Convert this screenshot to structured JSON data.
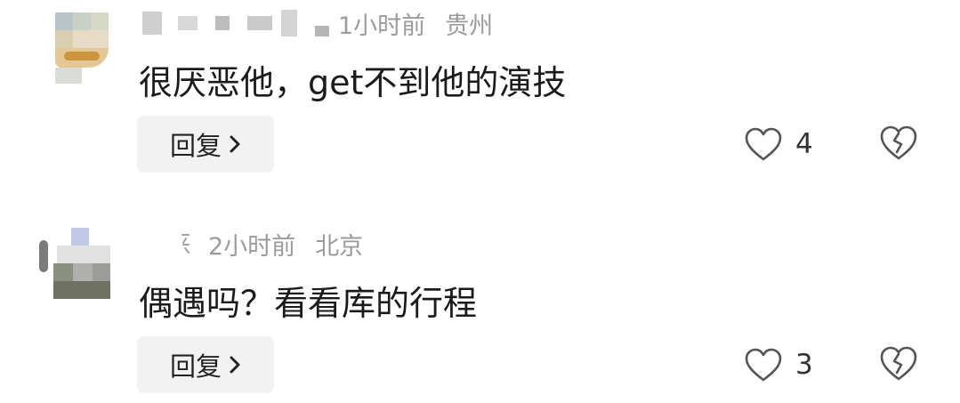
{
  "comments": [
    {
      "time": "1小时前",
      "location": "贵州",
      "text": "很厌恶他，get不到他的演技",
      "reply_label": "回复",
      "like_count": "4"
    },
    {
      "time": "2小时前",
      "location": "北京",
      "text": "偶遇吗？看看库的行程",
      "reply_label": "回复",
      "like_count": "3"
    }
  ],
  "icons": {
    "like": "heart-icon",
    "dislike": "broken-heart-icon",
    "reply_arrow": "chevron-right-icon"
  }
}
